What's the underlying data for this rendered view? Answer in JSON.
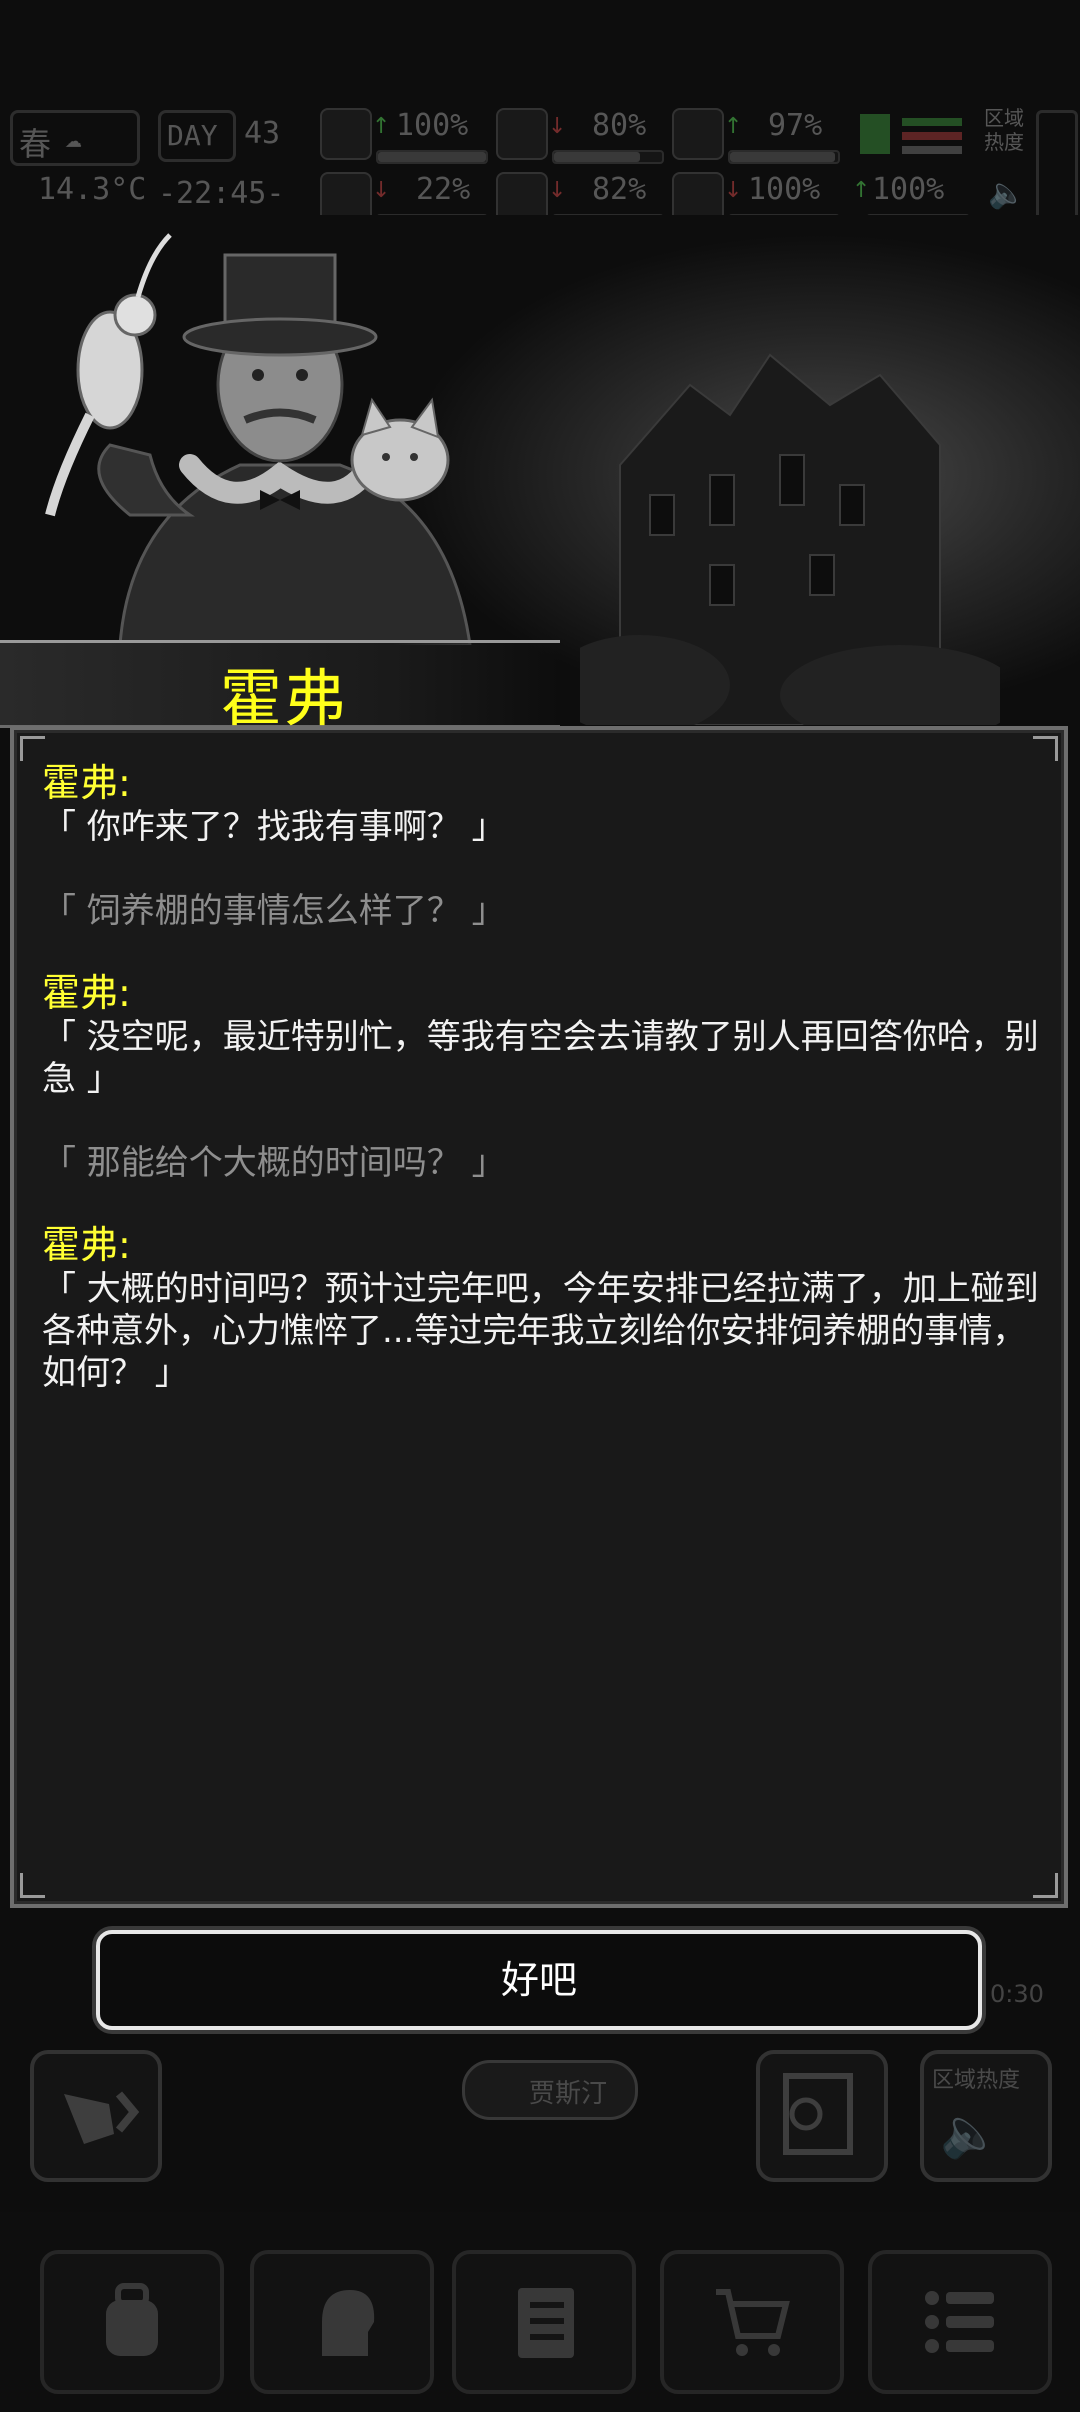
{
  "hud": {
    "season": "春",
    "temperature": "14.3°C",
    "day_label": "DAY",
    "day_number": "43",
    "clock": "-22:45-",
    "region_heat_label": "区域\n热度",
    "stats": [
      {
        "name": "health",
        "value": "100%",
        "level": 1.0
      },
      {
        "name": "hunger",
        "value": "80%",
        "level": 0.8
      },
      {
        "name": "mood",
        "value": "97%",
        "level": 0.97
      },
      {
        "name": "injury",
        "value": "22%",
        "level": 0.22
      },
      {
        "name": "thirst",
        "value": "82%",
        "level": 0.82
      },
      {
        "name": "heart",
        "value": "100%",
        "level": 1.0
      },
      {
        "name": "stamina",
        "value": "100%",
        "level": 1.0
      }
    ]
  },
  "npc": {
    "name": "霍弗"
  },
  "dialog": {
    "entries": [
      {
        "speaker": "霍弗:",
        "text": "「 你咋来了？找我有事啊？ 」"
      },
      {
        "speaker": "",
        "text": "「 饲养棚的事情怎么样了？ 」"
      },
      {
        "speaker": "霍弗:",
        "text": "「 没空呢，最近特别忙，等我有空会去请教了别人再回答你哈，别急 」"
      },
      {
        "speaker": "",
        "text": "「 那能给个大概的时间吗？ 」"
      },
      {
        "speaker": "霍弗:",
        "text": "「 大概的时间吗？预计过完年吧，今年安排已经拉满了，加上碰到各种意外，心力憔悴了...等过完年我立刻给你安排饲养棚的事情，如何？ 」"
      }
    ]
  },
  "confirm_button": {
    "label": "好吧"
  },
  "background": {
    "npc_tag": "贾斯汀",
    "region_heat_button": "区域热度",
    "timer": "0:30"
  },
  "colors": {
    "speaker": "#ffff33",
    "npc_line": "#f2f2f2",
    "player_line": "#8e8e8e",
    "name_plate": "#ffff1a"
  }
}
